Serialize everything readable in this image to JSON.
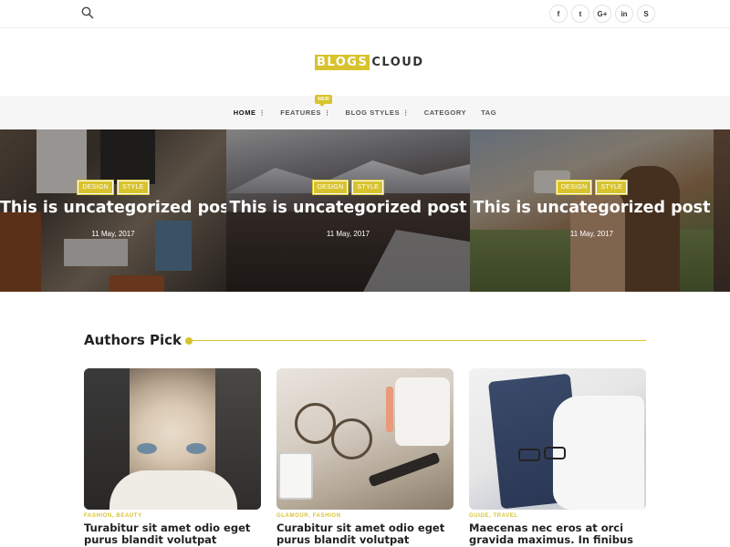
{
  "topbar": {
    "search_icon": "search-icon",
    "social": [
      {
        "name": "facebook-icon",
        "glyph": "f"
      },
      {
        "name": "twitter-icon",
        "glyph": "t"
      },
      {
        "name": "google-plus-icon",
        "glyph": "G+"
      },
      {
        "name": "linkedin-icon",
        "glyph": "in"
      },
      {
        "name": "skype-icon",
        "glyph": "S"
      }
    ]
  },
  "logo": {
    "part1": "BLOGS",
    "part2": "CLOUD"
  },
  "nav": {
    "items": [
      {
        "label": "HOME",
        "dots": "⋮"
      },
      {
        "label": "FEATURES",
        "dots": "⋮",
        "badge": "NEW"
      },
      {
        "label": "BLOG STYLES",
        "dots": "⋮"
      },
      {
        "label": "CATEGORY",
        "dots": ""
      },
      {
        "label": "TAG",
        "dots": ""
      }
    ]
  },
  "slider": {
    "slides": [
      {
        "tags": [
          "DESIGN",
          "STYLE"
        ],
        "title": "This is uncategorized post",
        "date": "11 May, 2017"
      },
      {
        "tags": [
          "DESIGN",
          "STYLE"
        ],
        "title": "This is uncategorized post",
        "date": "11 May, 2017"
      },
      {
        "tags": [
          "DESIGN",
          "STYLE"
        ],
        "title": "This is uncategorized post",
        "date": "11 May, 2017"
      }
    ]
  },
  "authors_pick": {
    "heading": "Authors Pick",
    "cards": [
      {
        "cats": "FASHION, BEAUTY",
        "title": "Turabitur sit amet odio eget purus blandit volutpat"
      },
      {
        "cats": "GLAMOUR, FASHION",
        "title": "Curabitur sit amet odio eget purus blandit volutpat"
      },
      {
        "cats": "GUIDE, TRAVEL",
        "title": "Maecenas nec eros at orci gravida maximus. In finibus lacinia urna"
      }
    ]
  },
  "colors": {
    "accent": "#d8c32e",
    "nav_bg": "#f6f6f6",
    "text": "#222222"
  }
}
